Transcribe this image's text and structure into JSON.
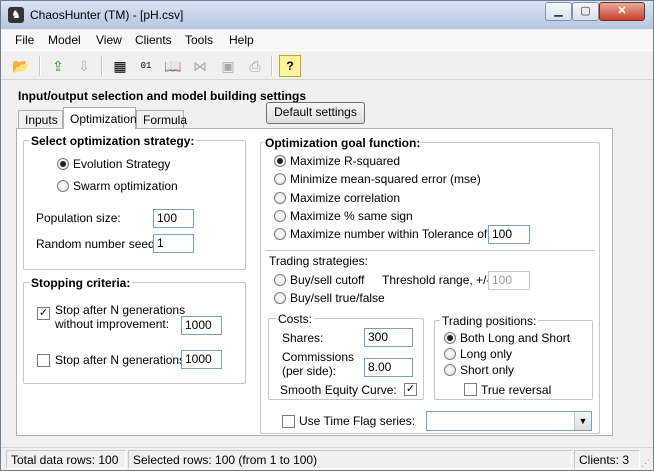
{
  "window": {
    "title": "ChaosHunter (TM) - [pH.csv]"
  },
  "menu": [
    "File",
    "Model",
    "View",
    "Clients",
    "Tools",
    "Help"
  ],
  "toolbar_icons": [
    "open-folder-icon",
    "upload-icon",
    "download-disabled-icon",
    "table-icon",
    "binary-icon",
    "book-icon",
    "network-disabled-icon",
    "save-disabled-icon",
    "print-disabled-icon",
    "help-icon"
  ],
  "section": {
    "title": "Input/output selection and model building settings"
  },
  "tabs": [
    "Inputs",
    "Optimization",
    "Formula"
  ],
  "default_button": "Default settings",
  "strategy": {
    "title": "Select optimization strategy:",
    "options": [
      "Evolution Strategy",
      "Swarm optimization"
    ],
    "selected": "Evolution Strategy",
    "population_label": "Population size:",
    "population_value": "100",
    "seed_label": "Random number seed:",
    "seed_value": "1"
  },
  "stopping": {
    "title": "Stopping criteria:",
    "opt1_line1": "Stop after N generations",
    "opt1_line2": "without improvement:",
    "opt1_checked": true,
    "opt1_value": "1000",
    "opt2_label": "Stop after N generations:",
    "opt2_checked": false,
    "opt2_value": "1000"
  },
  "goal": {
    "title": "Optimization goal function:",
    "options": [
      "Maximize R-squared",
      "Minimize mean-squared error (mse)",
      "Maximize correlation",
      "Maximize % same sign",
      "Maximize number within Tolerance of:"
    ],
    "selected": "Maximize R-squared",
    "tolerance_value": "100"
  },
  "trading": {
    "title": "Trading strategies:",
    "options": [
      "Buy/sell cutoff",
      "Buy/sell true/false"
    ],
    "threshold_label": "Threshold range, +/-",
    "threshold_value": "100"
  },
  "costs": {
    "title": "Costs:",
    "shares_label": "Shares:",
    "shares_value": "300",
    "commissions_line1": "Commissions",
    "commissions_line2": "(per side):",
    "commissions_value": "8.00",
    "smooth_label": "Smooth Equity Curve:",
    "smooth_checked": true
  },
  "positions": {
    "title": "Trading positions:",
    "options": [
      "Both Long and Short",
      "Long only",
      "Short only"
    ],
    "selected": "Both Long and Short",
    "reversal_label": "True reversal",
    "reversal_checked": false
  },
  "timeflag": {
    "label": "Use Time Flag series:",
    "checked": false,
    "value": ""
  },
  "status": {
    "total": "Total data rows: 100",
    "selected": "Selected rows: 100  (from 1 to 100)",
    "clients": "Clients: 3"
  }
}
